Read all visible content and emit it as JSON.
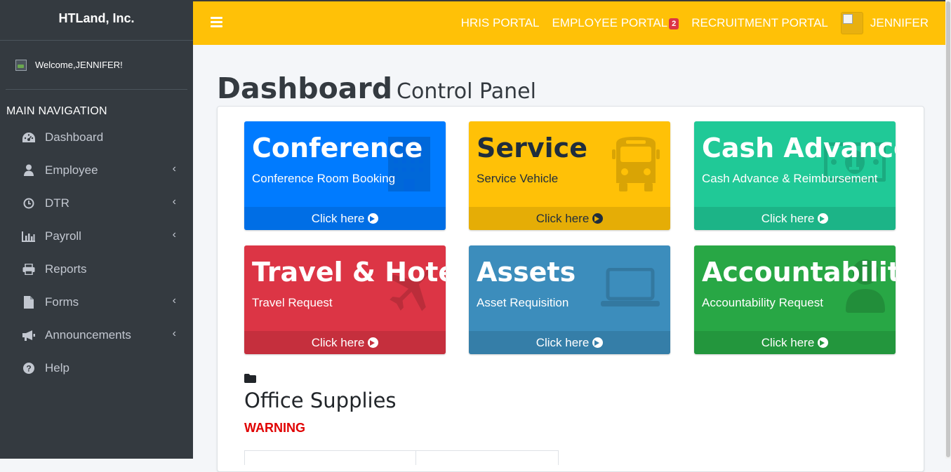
{
  "sidebar": {
    "brand": "HTLand, Inc.",
    "welcome": "Welcome,JENNIFER!",
    "nav_header": "MAIN NAVIGATION",
    "items": [
      {
        "label": "Dashboard",
        "icon": "dashboard-icon"
      },
      {
        "label": "Employee",
        "icon": "user-icon",
        "expandable": true
      },
      {
        "label": "DTR",
        "icon": "clock-icon",
        "expandable": true
      },
      {
        "label": "Payroll",
        "icon": "bar-chart-icon",
        "expandable": true
      },
      {
        "label": "Reports",
        "icon": "print-icon"
      },
      {
        "label": "Forms",
        "icon": "file-icon",
        "expandable": true
      },
      {
        "label": "Announcements",
        "icon": "bullhorn-icon",
        "expandable": true
      },
      {
        "label": "Help",
        "icon": "question-icon"
      }
    ]
  },
  "topbar": {
    "links": [
      "HRIS PORTAL",
      "EMPLOYEE PORTAL",
      "RECRUITMENT PORTAL"
    ],
    "employee_badge": "2",
    "user_name": "JENNIFER",
    "bar_color": "#ffc107"
  },
  "content": {
    "title": "Dashboard",
    "subtitle": "Control Panel",
    "tiles": [
      {
        "title": "Conference",
        "subtitle": "Conference Room Booking",
        "link": "Click here",
        "color": "#007bff",
        "icon": "building-icon"
      },
      {
        "title": "Service",
        "subtitle": "Service Vehicle",
        "link": "Click here",
        "color": "#ffc107",
        "icon": "bus-icon"
      },
      {
        "title": "Cash Advance",
        "subtitle": "Cash Advance & Reimbursement",
        "link": "Click here",
        "color": "#20c997",
        "icon": "money-icon"
      },
      {
        "title": "Travel & Hotel",
        "subtitle": "Travel Request",
        "link": "Click here",
        "color": "#dc3545",
        "icon": "plane-icon"
      },
      {
        "title": "Assets",
        "subtitle": "Asset Requisition",
        "link": "Click here",
        "color": "#3c8dbc",
        "icon": "laptop-icon"
      },
      {
        "title": "Accountability",
        "subtitle": "Accountability Request",
        "link": "Click here",
        "color": "#28a745",
        "icon": "user-check-icon"
      }
    ],
    "supplies_title": "Office Supplies",
    "warning": "WARNING",
    "warning_color": "#e00000"
  }
}
